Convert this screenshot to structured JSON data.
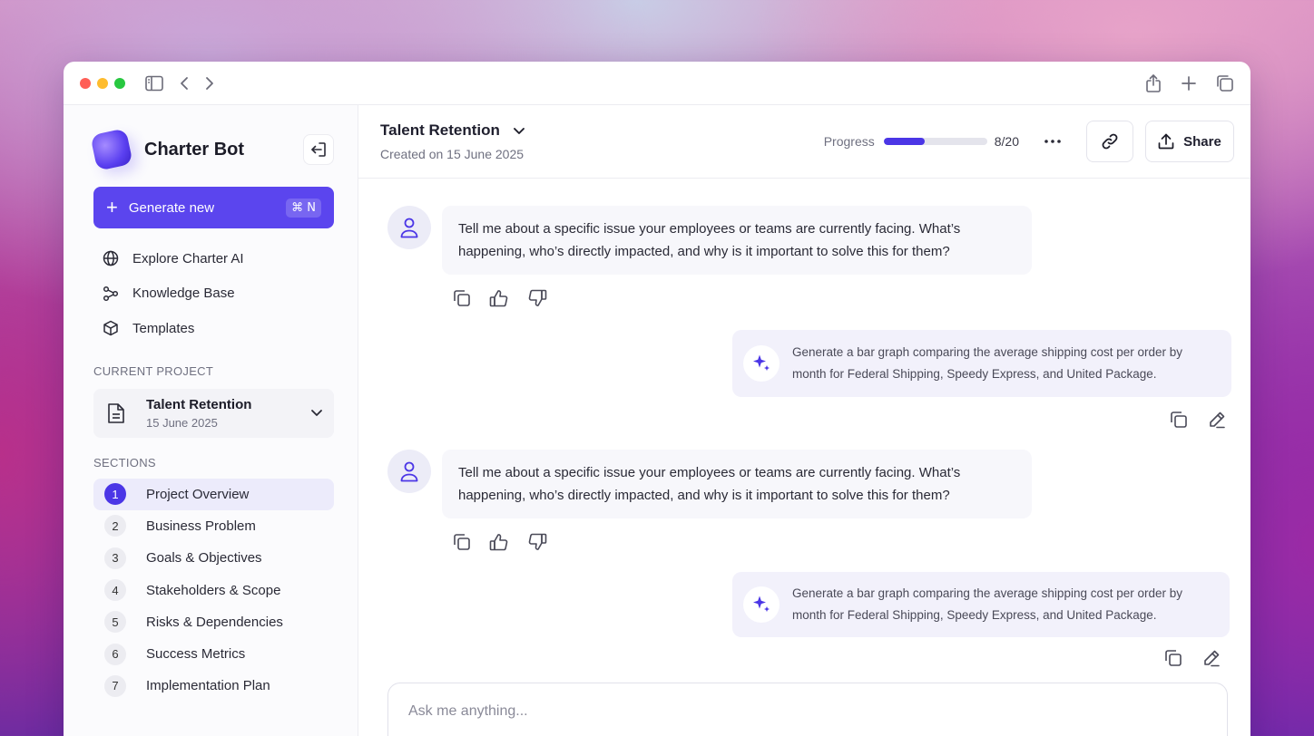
{
  "sidebar": {
    "brand_name": "Charter Bot",
    "generate_label": "Generate new",
    "generate_shortcut": "⌘ N",
    "nav": [
      {
        "label": "Explore Charter AI",
        "icon": "globe-icon"
      },
      {
        "label": "Knowledge Base",
        "icon": "share-nodes-icon"
      },
      {
        "label": "Templates",
        "icon": "cube-icon"
      }
    ],
    "current_project_label": "CURRENT PROJECT",
    "project": {
      "title": "Talent Retention",
      "date": "15 June 2025"
    },
    "sections_label": "SECTIONS",
    "sections": [
      {
        "num": "1",
        "label": "Project Overview",
        "active": true
      },
      {
        "num": "2",
        "label": "Business Problem"
      },
      {
        "num": "3",
        "label": "Goals & Objectives"
      },
      {
        "num": "4",
        "label": "Stakeholders & Scope"
      },
      {
        "num": "5",
        "label": "Risks & Dependencies"
      },
      {
        "num": "6",
        "label": "Success Metrics"
      },
      {
        "num": "7",
        "label": "Implementation Plan"
      }
    ]
  },
  "header": {
    "title": "Talent Retention",
    "subtitle": "Created on 15 June 2025",
    "progress_label": "Progress",
    "progress_value": 0.4,
    "progress_count": "8/20",
    "share_label": "Share"
  },
  "messages": [
    {
      "role": "bot",
      "text": "Tell me about a specific issue your employees or teams are currently facing. What’s happening, who’s directly impacted, and why is it important to solve this for them?"
    },
    {
      "role": "user",
      "text": "Generate a bar graph comparing the average shipping cost per order by month for Federal Shipping, Speedy Express, and United Package."
    },
    {
      "role": "bot",
      "text": "Tell me about a specific issue your employees or teams are currently facing. What’s happening, who’s directly impacted, and why is it important to solve this for them?"
    },
    {
      "role": "user",
      "text": "Generate a bar graph comparing the average shipping cost per order by month for Federal Shipping, Speedy Express, and United Package."
    }
  ],
  "composer": {
    "placeholder": "Ask me anything..."
  },
  "colors": {
    "accent": "#5b45ee",
    "active_num": "#4b36e6",
    "traffic_red": "#ff5f57",
    "traffic_yellow": "#febc2e",
    "traffic_green": "#28c840"
  }
}
